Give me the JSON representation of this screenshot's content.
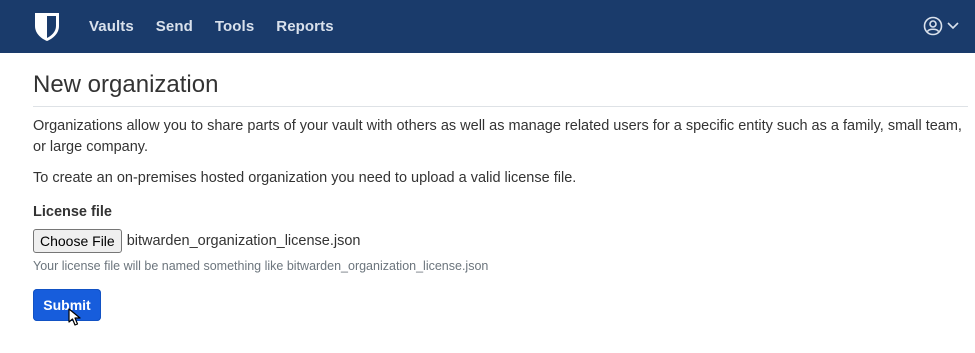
{
  "nav": {
    "logo_icon": "bitwarden-shield-icon",
    "links": [
      "Vaults",
      "Send",
      "Tools",
      "Reports"
    ],
    "user_icon": "user-circle-icon",
    "caret_icon": "caret-down-icon"
  },
  "page": {
    "title": "New organization",
    "description": "Organizations allow you to share parts of your vault with others as well as manage related users for a specific entity such as a family, small team, or large company.",
    "onprem_note": "To create an on-premises hosted organization you need to upload a valid license file."
  },
  "form": {
    "license_label": "License file",
    "choose_file_label": "Choose File",
    "selected_file": "bitwarden_organization_license.json",
    "help_text": "Your license file will be named something like bitwarden_organization_license.json",
    "submit_label": "Submit"
  },
  "colors": {
    "navbar": "#1a3b6b",
    "primary": "#175ddc"
  }
}
